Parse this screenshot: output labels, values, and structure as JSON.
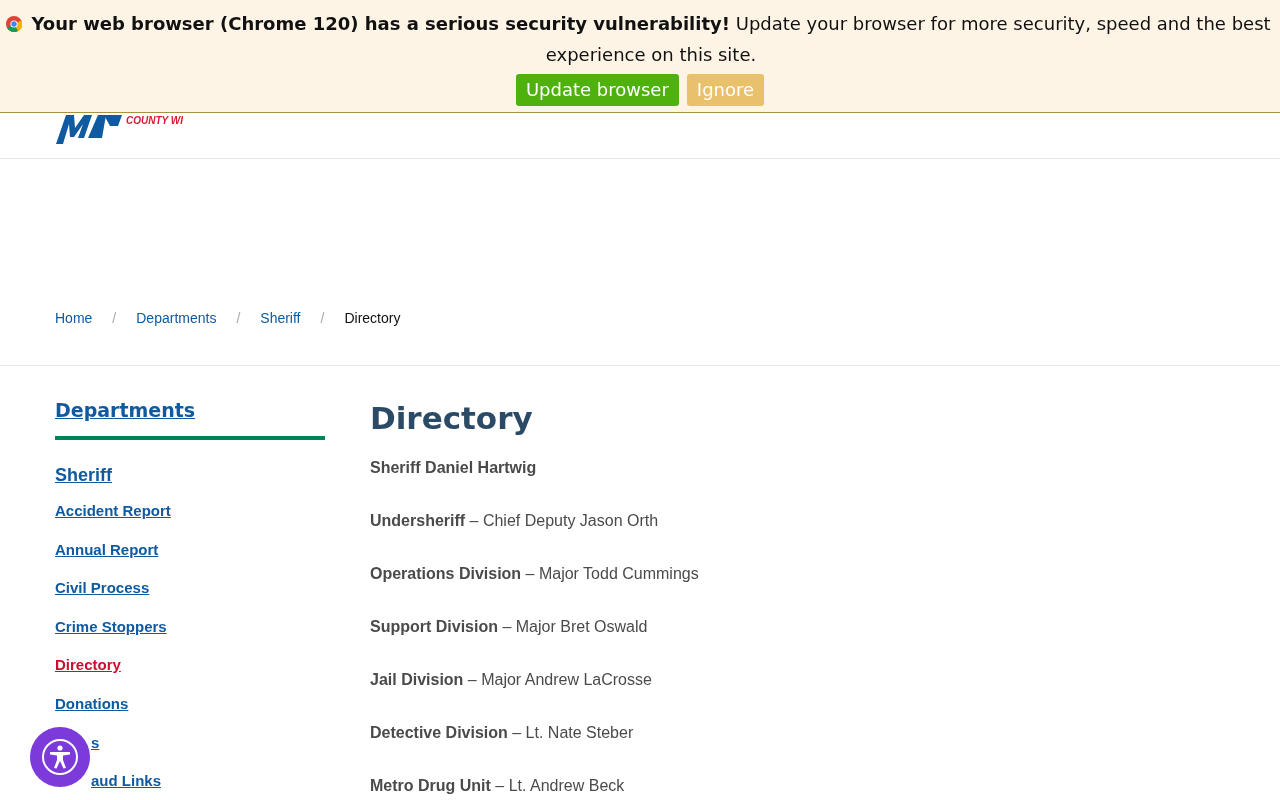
{
  "update_banner": {
    "message": "**Your web browser (Chrome 120) has a serious security vulnerability!** Update your browser for more security, speed and the best experience on this site.",
    "buttons": [
      {
        "label": "Update browser",
        "kind": "primary"
      },
      {
        "label": "Ignore",
        "kind": "secondary"
      }
    ]
  },
  "header": {
    "logo_subtitle": "COUNTY WI"
  },
  "breadcrumb": {
    "separator": "/",
    "items": [
      {
        "label": "Home",
        "current": false
      },
      {
        "label": "Departments",
        "current": false
      },
      {
        "label": "Sheriff",
        "current": false
      },
      {
        "label": "Directory",
        "current": true
      }
    ]
  },
  "sidebar": {
    "title": "Departments",
    "items": [
      {
        "label": "Sheriff",
        "kind": "parent",
        "selected": false
      },
      {
        "label": "Accident Report",
        "kind": "link",
        "selected": false
      },
      {
        "label": "Annual Report",
        "kind": "link",
        "selected": false
      },
      {
        "label": "Civil Process",
        "kind": "link",
        "selected": false
      },
      {
        "label": "Crime Stoppers",
        "kind": "link",
        "selected": false
      },
      {
        "label": "Directory",
        "kind": "link",
        "selected": true
      },
      {
        "label": "Donations",
        "kind": "link",
        "selected": false
      },
      {
        "label": "s",
        "kind": "covered",
        "selected": false
      },
      {
        "label": "aud Links",
        "kind": "covered",
        "selected": false
      }
    ]
  },
  "content": {
    "title": "Directory",
    "entries": [
      "**Sheriff Daniel Hartwig**",
      "**Undersheriff** – Chief Deputy Jason Orth",
      "**Operations Division** – Major Todd Cummings",
      "**Support Division** – Major Bret Oswald",
      "**Jail Division** – Major Andrew LaCrosse",
      "**Detective Division** – Lt. Nate Steber",
      "**Metro Drug Unit** – Lt. Andrew Beck"
    ]
  }
}
